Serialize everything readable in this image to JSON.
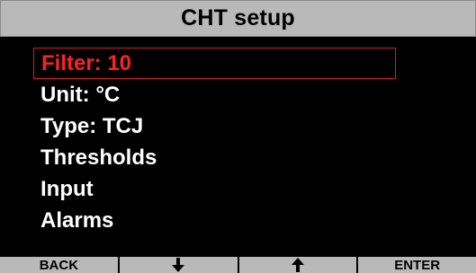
{
  "title": "CHT setup",
  "menu": {
    "selected_index": 0,
    "items": [
      {
        "label": "Filter: 10"
      },
      {
        "label": "Unit: °C"
      },
      {
        "label": "Type: TCJ"
      },
      {
        "label": "Thresholds"
      },
      {
        "label": "Input"
      },
      {
        "label": "Alarms"
      }
    ]
  },
  "softkeys": [
    {
      "label": "BACK",
      "icon": null
    },
    {
      "label": "",
      "icon": "arrow-down-icon"
    },
    {
      "label": "",
      "icon": "arrow-up-icon"
    },
    {
      "label": "ENTER",
      "icon": null
    }
  ],
  "colors": {
    "background": "#000000",
    "bar": "#b9b9b9",
    "highlight": "#ff2020",
    "text": "#ffffff"
  }
}
